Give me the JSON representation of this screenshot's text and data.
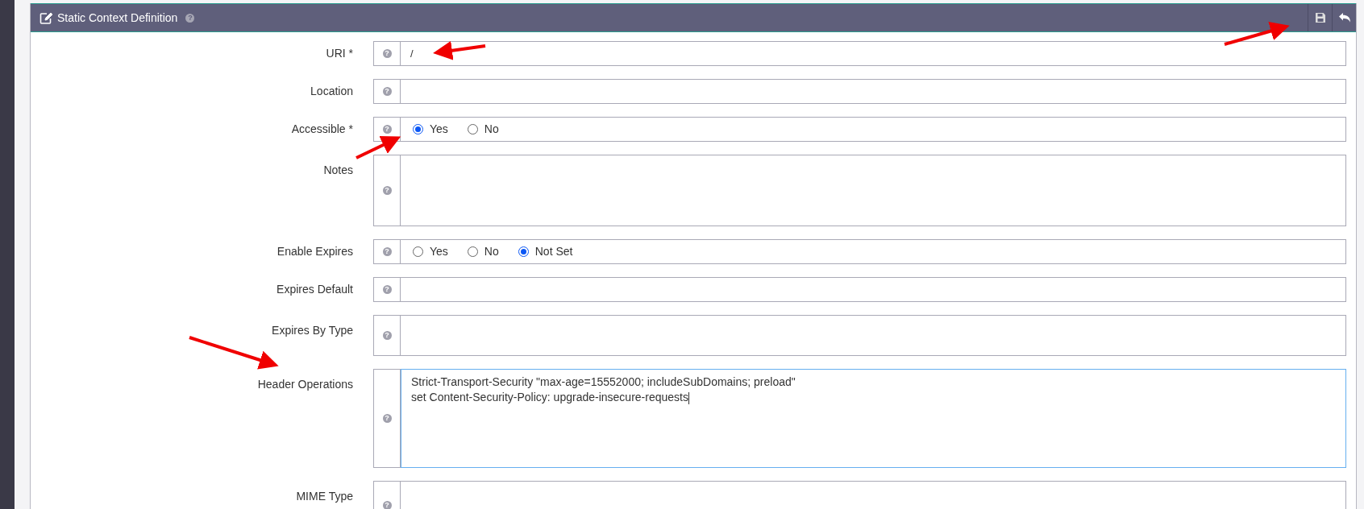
{
  "panel": {
    "title": "Static Context Definition",
    "help_icon": "?"
  },
  "fields": [
    {
      "kind": "text",
      "label": "URI *",
      "value": "/",
      "help": "?"
    },
    {
      "kind": "text",
      "label": "Location",
      "help": "?"
    },
    {
      "kind": "radio",
      "label": "Accessible *",
      "help": "?",
      "options": [
        {
          "label": "Yes",
          "selected": true
        },
        {
          "label": "No",
          "selected": false
        }
      ]
    },
    {
      "kind": "textarea",
      "label": "Notes",
      "help": "?",
      "focused": false
    },
    {
      "kind": "radio",
      "label": "Enable Expires",
      "help": "?",
      "options": [
        {
          "label": "Yes",
          "selected": false
        },
        {
          "label": "No",
          "selected": false
        },
        {
          "label": "Not Set",
          "selected": true
        }
      ]
    },
    {
      "kind": "text",
      "label": "Expires Default",
      "help": "?"
    },
    {
      "kind": "textarea",
      "label": "Expires By Type",
      "help": "?",
      "focused": false
    },
    {
      "kind": "textarea",
      "label": "Header Operations",
      "help": "?",
      "focused": true,
      "value": "Strict-Transport-Security \"max-age=15552000; includeSubDomains; preload\"\nset Content-Security-Policy: upgrade-insecure-requests"
    },
    {
      "kind": "textarea",
      "label": "MIME Type",
      "help": "?",
      "focused": false
    }
  ]
}
